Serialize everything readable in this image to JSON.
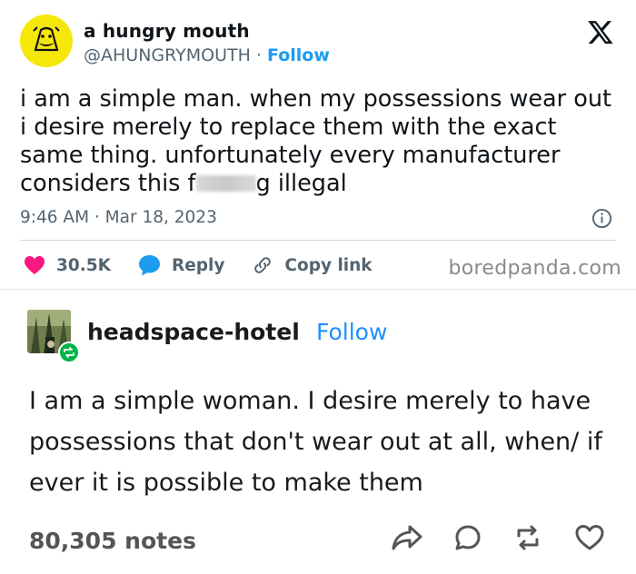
{
  "tweet": {
    "display_name": "a hungry mouth",
    "handle": "@AHUNGRYMOUTH",
    "separator": "·",
    "follow_label": "Follow",
    "text_before": "i am a simple man. when my possessions wear out i desire merely to replace them with the exact same thing. unfortunately every manufacturer considers this f",
    "text_after": "g illegal",
    "timestamp": "9:46 AM · Mar 18, 2023",
    "like_count": "30.5K",
    "reply_label": "Reply",
    "copy_link_label": "Copy link",
    "colors": {
      "accent": "#1d9bf0",
      "like": "#f91880",
      "avatar_bg": "#f6e70b"
    }
  },
  "watermark": "boredpanda.com",
  "tumblr": {
    "username": "headspace-hotel",
    "follow_label": "Follow",
    "text": "I am a simple woman. I desire merely to have possessions that don't wear out at all, when/ if ever it is possible to make them",
    "notes": "80,305 notes",
    "icons": [
      "share-icon",
      "comment-icon",
      "reblog-icon",
      "heart-icon"
    ],
    "colors": {
      "follow": "#1e90ff",
      "reblog_badge": "#00b34a"
    }
  }
}
